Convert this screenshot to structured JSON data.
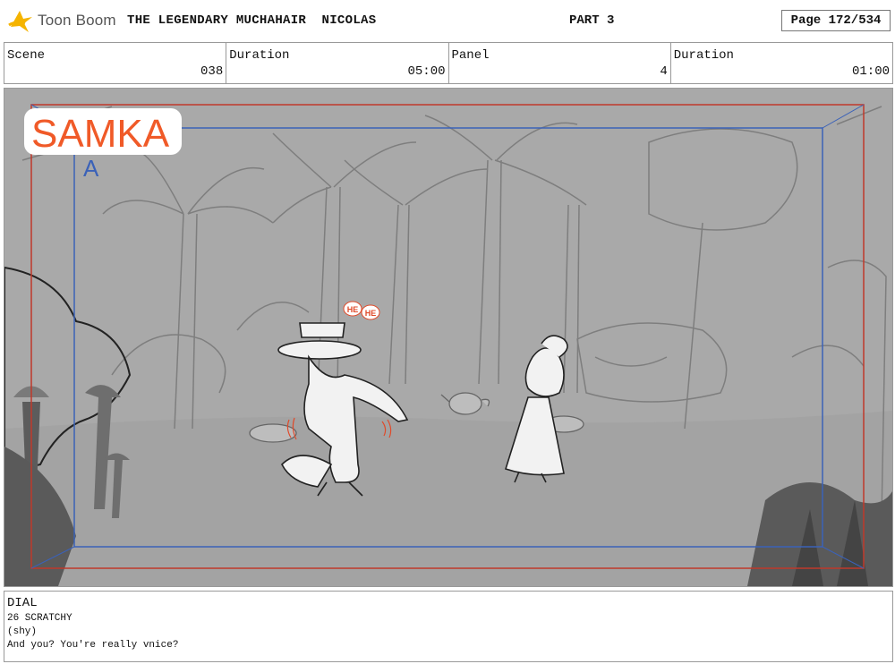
{
  "header": {
    "brand": "Toon Boom",
    "project_title": "THE LEGENDARY MUCHAHAIR  NICOLAS",
    "part": "PART 3",
    "page": "Page 172/534"
  },
  "info": {
    "scene_label": "Scene",
    "scene_value": "038",
    "duration_label": "Duration",
    "duration_value": "05:00",
    "panel_label": "Panel",
    "panel_value": "4",
    "panel_duration_label": "Duration",
    "panel_duration_value": "01:00"
  },
  "frame": {
    "studio_logo": "SAMKA",
    "layer_mark": "A",
    "sfx_1": "HE",
    "sfx_2": "HE"
  },
  "dialogue": {
    "header": "DIAL",
    "lines": [
      "26 SCRATCHY",
      "(shy)",
      "And you? You're really vnice?"
    ]
  },
  "colors": {
    "logo_orange": "#f05a28",
    "logo_blue": "#2a6bc4",
    "safe_frame_red": "#c0392b",
    "safe_frame_blue": "#3b62b8",
    "sketch_bg": "#a9a9a9",
    "brand_yellow": "#f5b400"
  }
}
